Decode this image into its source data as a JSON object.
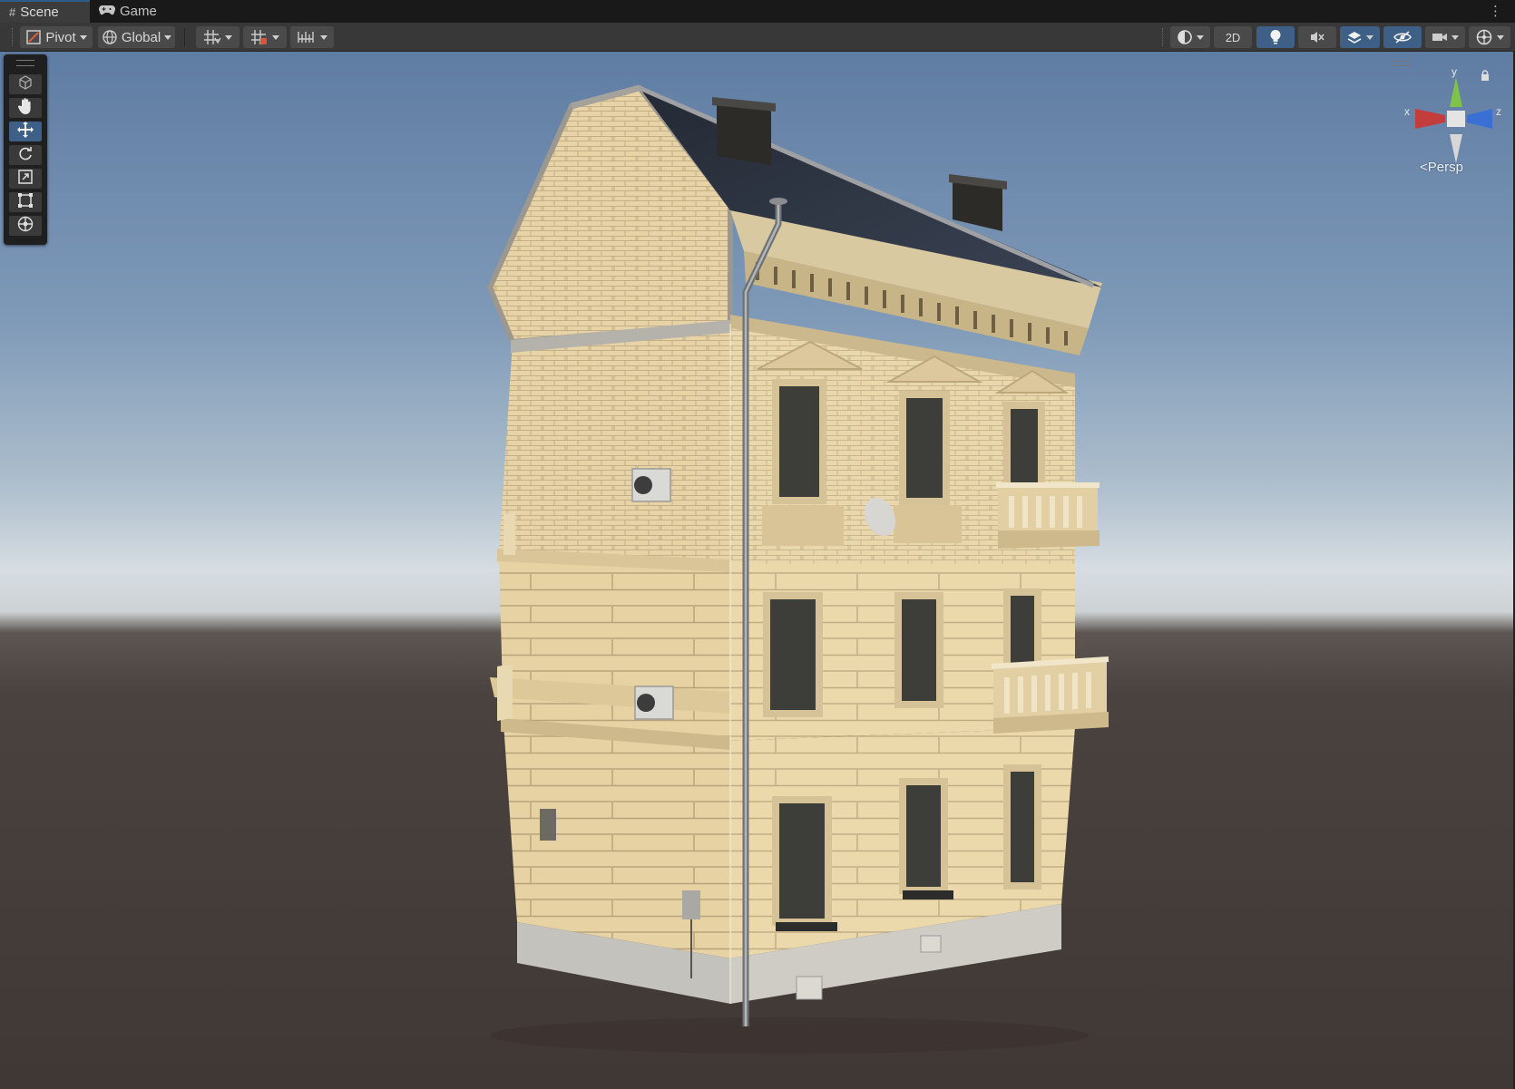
{
  "tabs": [
    {
      "label": "Scene",
      "icon": "grid-hash-icon",
      "active": true
    },
    {
      "label": "Game",
      "icon": "gamepad-icon",
      "active": false
    }
  ],
  "toolbar": {
    "pivot_label": "Pivot",
    "global_label": "Global",
    "mode_2d_label": "2D"
  },
  "gizmo": {
    "axis_y": "y",
    "axis_x": "x",
    "axis_z": "z",
    "projection_label": "Persp"
  },
  "colors": {
    "selected_blue": "#3e5f86",
    "toolbar_bg": "#383838",
    "tab_bar_bg": "#191919",
    "facade_color": "#e8d4a4",
    "roof_color": "#2e3541"
  },
  "tools": [
    "view-tool",
    "hand-tool",
    "move-tool",
    "rotate-tool",
    "scale-tool",
    "rect-tool",
    "transform-tool"
  ],
  "selected_tool": "move-tool"
}
